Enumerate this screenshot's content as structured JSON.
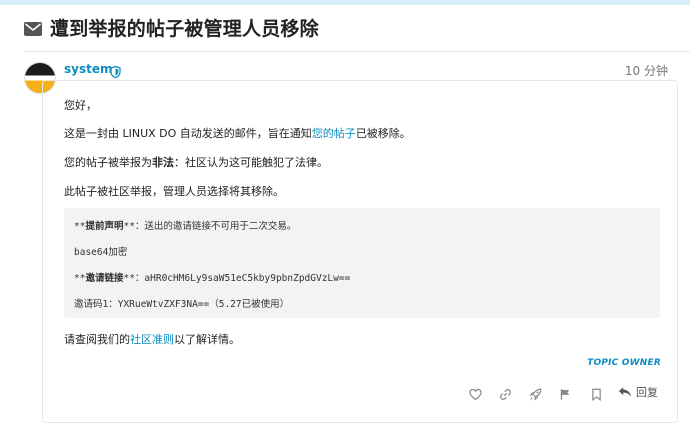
{
  "topic": {
    "title": "遭到举报的帖子被管理人员移除"
  },
  "post": {
    "username": "system",
    "time_ago": "10 分钟",
    "greeting": "您好，",
    "line1_prefix": "这是一封由 LINUX DO 自动发送的邮件，旨在通知",
    "line1_link": "您的帖子",
    "line1_suffix": "已被移除。",
    "line2_prefix": "您的帖子被举报为",
    "line2_strong": "非法",
    "line2_suffix": "：社区认为这可能触犯了法律。",
    "line3": "此帖子被社区举报，管理人员选择将其移除。",
    "quote": {
      "l1_prefix": "**",
      "l1_strong": "提前声明",
      "l1_suffix": "**：送出的邀请链接不可用于二次交易。",
      "l2": "base64加密",
      "l3_prefix": "**",
      "l3_strong": "邀请链接",
      "l3_suffix": "**：aHR0cHM6Ly9saW51eC5kby9pbnZpdGVzLw==",
      "l4": "邀请码1：YXRueWtvZXF3NA==（5.27已被使用）"
    },
    "footer_prefix": "请查阅我们的",
    "footer_link": "社区准则",
    "footer_suffix": "以了解详情。",
    "badge": "TOPIC OWNER"
  },
  "actions": {
    "reply_label": "回复"
  },
  "colors": {
    "accent": "#0b8ec2",
    "top_strip": "#d6f0fb",
    "quote_bg": "#f3f3f3"
  }
}
